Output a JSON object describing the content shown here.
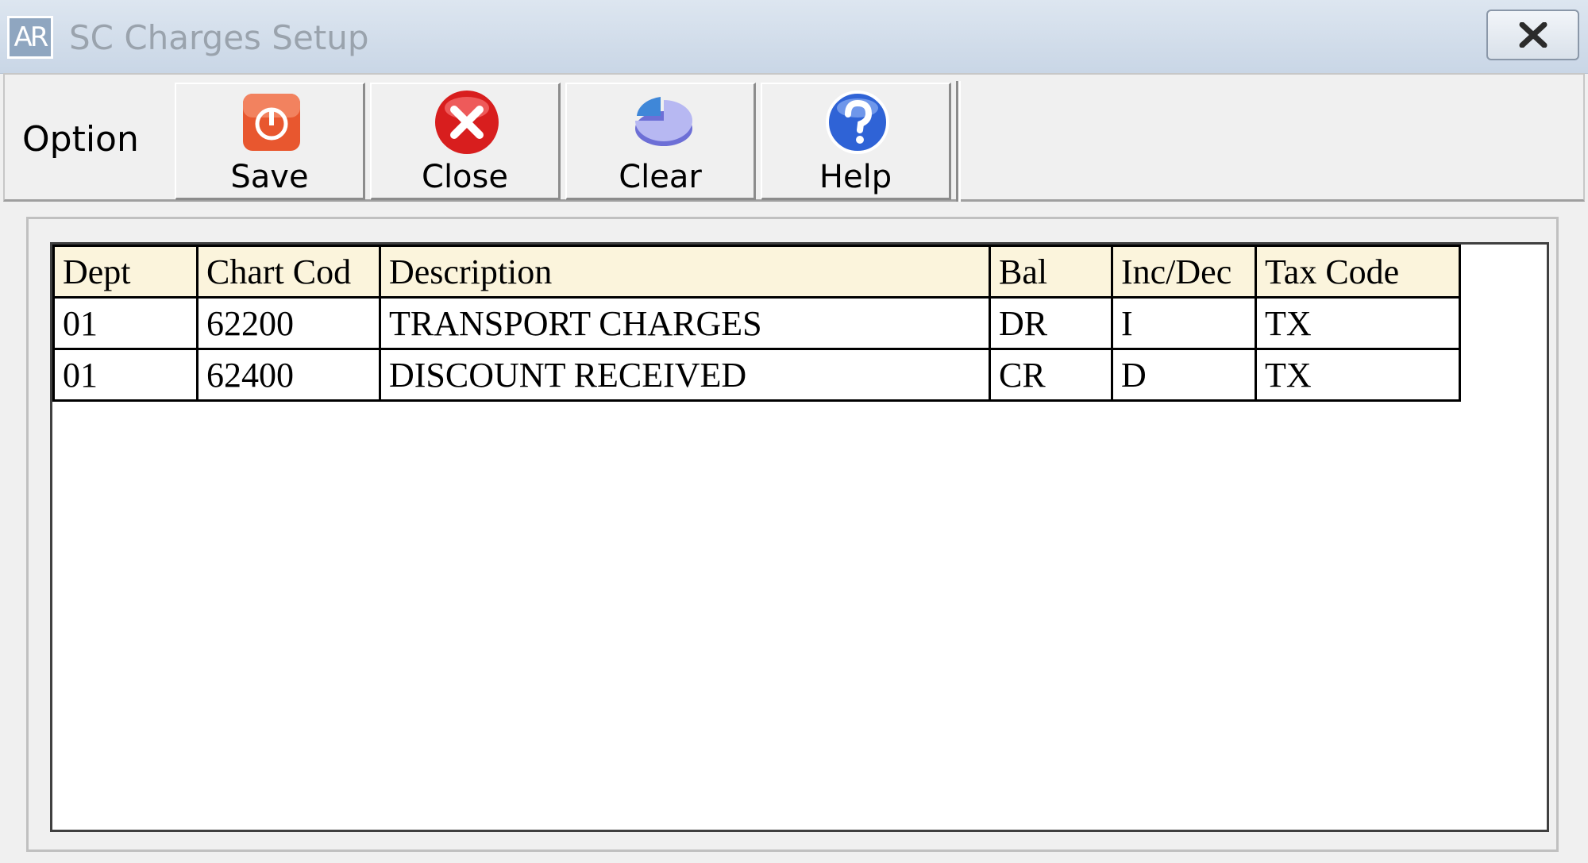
{
  "window": {
    "app_icon_text": "AR",
    "title": "SC Charges Setup"
  },
  "toolbar": {
    "group_label": "Option",
    "buttons": [
      {
        "label": "Save",
        "icon": "power-save-icon"
      },
      {
        "label": "Close",
        "icon": "red-x-close-icon"
      },
      {
        "label": "Clear",
        "icon": "pie-clear-icon"
      },
      {
        "label": "Help",
        "icon": "question-help-icon"
      }
    ]
  },
  "grid": {
    "columns": [
      "Dept",
      "Chart Cod",
      "Description",
      "Bal",
      "Inc/Dec",
      "Tax Code"
    ],
    "rows": [
      [
        "01",
        "62200",
        "TRANSPORT CHARGES",
        "DR",
        "I",
        "TX"
      ],
      [
        "01",
        "62400",
        "DISCOUNT RECEIVED",
        "CR",
        "D",
        "TX"
      ]
    ]
  },
  "colors": {
    "header_bg": "#fbf4dc",
    "save_icon": "#e8572f",
    "close_icon": "#d81e1e",
    "help_icon": "#2f63d6"
  }
}
